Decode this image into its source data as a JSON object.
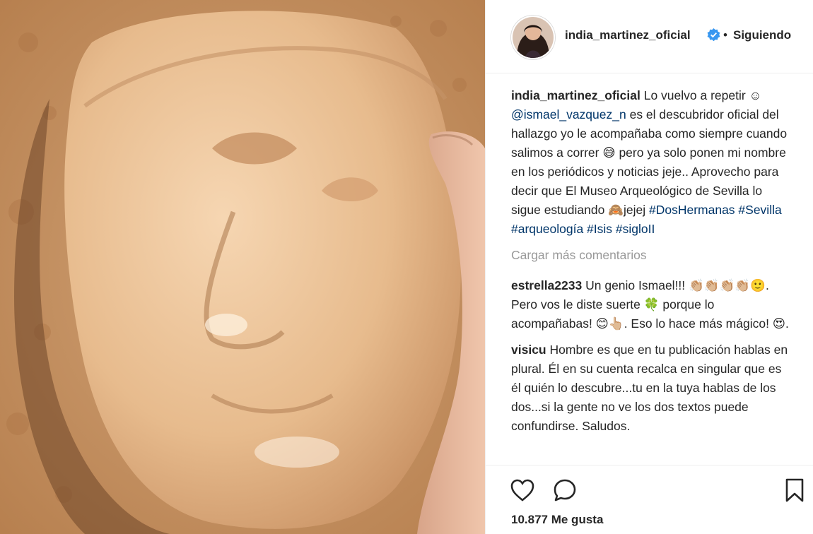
{
  "photo": {
    "alt_hidden": ""
  },
  "header": {
    "username": "india_martinez_oficial",
    "separator": "•",
    "follow_status": "Siguiendo"
  },
  "caption": {
    "username": "india_martinez_oficial",
    "text_1": "Lo vuelvo a repetir ☺ ",
    "mention": "@ismael_vazquez_n",
    "text_2": " es el descubridor oficial del hallazgo yo le acompañaba como siempre cuando salimos a correr 😅 pero ya solo ponen mi nombre en los periódicos y noticias jeje.. Aprovecho para decir que El Museo Arqueológico de Sevilla lo sigue estudiando 🙈jejej ",
    "hashtags": "#DosHermanas #Sevilla #arqueología #Isis #sigloII"
  },
  "load_more": "Cargar más comentarios",
  "comments": [
    {
      "username": "estrella2233",
      "text": "Un genio Ismael!!! 👏🏼👏🏼👏🏼👏🏼🙂. Pero vos le diste suerte 🍀 porque lo acompañabas! 😊👆🏼. Eso lo hace más mágico! 😍."
    },
    {
      "username": "visicu",
      "text": "Hombre es que en tu publicación hablas en plural. Él en su cuenta recalca en singular que es él quién lo descubre...tu en la tuya hablas de los dos...si la gente no ve los dos textos puede confundirse. Saludos."
    }
  ],
  "likes": "10.877 Me gusta",
  "icons": {
    "like": "heart-icon",
    "comment": "comment-icon",
    "save": "bookmark-icon",
    "verified": "verified-badge-icon"
  },
  "colors": {
    "link": "#003569",
    "verified": "#3897f0",
    "muted": "#999999"
  }
}
